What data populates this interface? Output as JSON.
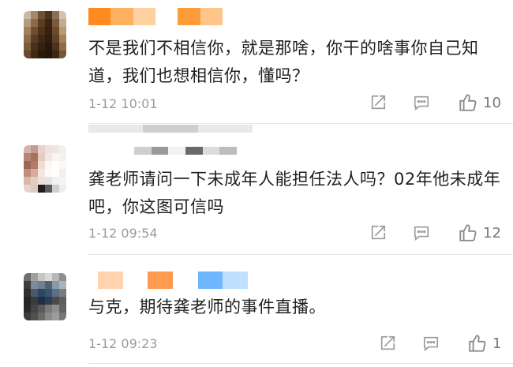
{
  "comments": [
    {
      "text": "不是我们不相信你，就是那啥，你干的啥事你自己知道，我们也想相信你，懂吗？",
      "time": "1-12 10:01",
      "likes": "10",
      "avatar_colors": [
        "#c9b9a6",
        "#a4896a",
        "#6d5238",
        "#4a3421",
        "#8a6f55",
        "#d2c2ae",
        "#b79a7a",
        "#8c6a47",
        "#5b3d22",
        "#3b2614",
        "#7a5a3c",
        "#c4ab8e",
        "#a0815f",
        "#6f4f32",
        "#4e321c",
        "#36220f",
        "#6b4b2f",
        "#b9996f",
        "#8e6e4a",
        "#5a3c22",
        "#3f2815",
        "#2f1d0e",
        "#5f4128",
        "#a38257",
        "#7b5b3a",
        "#4a3019",
        "#33200f",
        "#291808",
        "#4b321e",
        "#8d6d47",
        "#68492e",
        "#3f2913",
        "#2a1a0a",
        "#241507",
        "#3c2714",
        "#765735"
      ],
      "username_colors": [
        "#ff8a1f",
        "#ffb060",
        "#ffd1a0",
        "#fff",
        "#ff9c3a",
        "#ffc58a"
      ]
    },
    {
      "text": "龚老师请问一下未成年人能担任法人吗？02年他未成年吧，你这图可信吗",
      "time": "1-12 09:54",
      "likes": "12",
      "avatar_colors": [
        "#d7b4a9",
        "#c89a8d",
        "#e8d3cc",
        "#f0e2dc",
        "#efe6e2",
        "#f5efec",
        "#b78576",
        "#a8705f",
        "#e5cbc2",
        "#f3e7e2",
        "#faf5f2",
        "#f7f1ee",
        "#9e6656",
        "#b57a68",
        "#f0dcd4",
        "#fbf7f5",
        "#ffffff",
        "#fbf8f6",
        "#c08d7c",
        "#d6ad9e",
        "#f4e6e0",
        "#fdfbfa",
        "#ffffff",
        "#f6efec",
        "#d9b8ab",
        "#e6cdc3",
        "#ece0db",
        "#e4e4e4",
        "#f2f2f2",
        "#f7f5f4",
        "#e5d2ca",
        "#dccbc3",
        "#1f1f1f",
        "#5c5c5c",
        "#cfcfcf",
        "#f0eeec"
      ],
      "username_colors": [
        "#cfcfcf",
        "#9a9a9a",
        "#f2f2f2",
        "#6a6a6a",
        "#dcdcdc",
        "#bdbdbd"
      ]
    },
    {
      "text": "与克，期待龚老师的事件直播。",
      "time": "1-12 09:23",
      "likes": "1",
      "avatar_colors": [
        "#6e6e6e",
        "#a0a0a0",
        "#c6c6c6",
        "#d9d9d9",
        "#b7b7b7",
        "#8f8f8f",
        "#3d3d3d",
        "#7f8a96",
        "#6d7f92",
        "#4f6378",
        "#8b98a6",
        "#a9b3bd",
        "#2f2f2f",
        "#4a5a6a",
        "#2e4560",
        "#3a536e",
        "#5c6f83",
        "#7a7a7a",
        "#252525",
        "#3a3a3a",
        "#1e3046",
        "#2b3e55",
        "#4b4b4b",
        "#5e5e5e",
        "#2a2a2a",
        "#454545",
        "#5a5a5a",
        "#7a7a7a",
        "#8e8e8e",
        "#636363",
        "#3b3b3b",
        "#505050",
        "#6a6a6a",
        "#8a8a8a",
        "#9c9c9c",
        "#777777"
      ],
      "username_colors": [
        "#ffd2b0",
        "#ffffff",
        "#ff9a50",
        "#ffffff",
        "#6fb6ff",
        "#bfe0ff"
      ]
    }
  ],
  "reply_strip_colors": [
    "#e9e9e9",
    "#cfcfcf",
    "#e9e9e9"
  ]
}
